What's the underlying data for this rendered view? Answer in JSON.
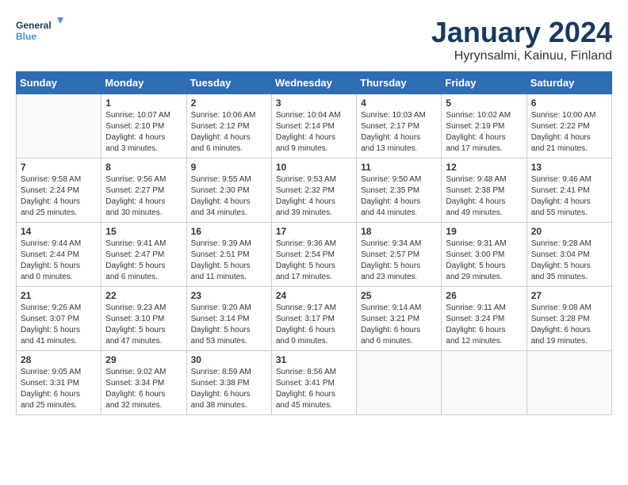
{
  "header": {
    "logo_line1": "General",
    "logo_line2": "Blue",
    "month": "January 2024",
    "location": "Hyrynsalmi, Kainuu, Finland"
  },
  "days_of_week": [
    "Sunday",
    "Monday",
    "Tuesday",
    "Wednesday",
    "Thursday",
    "Friday",
    "Saturday"
  ],
  "weeks": [
    [
      {
        "day": "",
        "info": ""
      },
      {
        "day": "1",
        "info": "Sunrise: 10:07 AM\nSunset: 2:10 PM\nDaylight: 4 hours\nand 3 minutes."
      },
      {
        "day": "2",
        "info": "Sunrise: 10:06 AM\nSunset: 2:12 PM\nDaylight: 4 hours\nand 6 minutes."
      },
      {
        "day": "3",
        "info": "Sunrise: 10:04 AM\nSunset: 2:14 PM\nDaylight: 4 hours\nand 9 minutes."
      },
      {
        "day": "4",
        "info": "Sunrise: 10:03 AM\nSunset: 2:17 PM\nDaylight: 4 hours\nand 13 minutes."
      },
      {
        "day": "5",
        "info": "Sunrise: 10:02 AM\nSunset: 2:19 PM\nDaylight: 4 hours\nand 17 minutes."
      },
      {
        "day": "6",
        "info": "Sunrise: 10:00 AM\nSunset: 2:22 PM\nDaylight: 4 hours\nand 21 minutes."
      }
    ],
    [
      {
        "day": "7",
        "info": "Sunrise: 9:58 AM\nSunset: 2:24 PM\nDaylight: 4 hours\nand 25 minutes."
      },
      {
        "day": "8",
        "info": "Sunrise: 9:56 AM\nSunset: 2:27 PM\nDaylight: 4 hours\nand 30 minutes."
      },
      {
        "day": "9",
        "info": "Sunrise: 9:55 AM\nSunset: 2:30 PM\nDaylight: 4 hours\nand 34 minutes."
      },
      {
        "day": "10",
        "info": "Sunrise: 9:53 AM\nSunset: 2:32 PM\nDaylight: 4 hours\nand 39 minutes."
      },
      {
        "day": "11",
        "info": "Sunrise: 9:50 AM\nSunset: 2:35 PM\nDaylight: 4 hours\nand 44 minutes."
      },
      {
        "day": "12",
        "info": "Sunrise: 9:48 AM\nSunset: 2:38 PM\nDaylight: 4 hours\nand 49 minutes."
      },
      {
        "day": "13",
        "info": "Sunrise: 9:46 AM\nSunset: 2:41 PM\nDaylight: 4 hours\nand 55 minutes."
      }
    ],
    [
      {
        "day": "14",
        "info": "Sunrise: 9:44 AM\nSunset: 2:44 PM\nDaylight: 5 hours\nand 0 minutes."
      },
      {
        "day": "15",
        "info": "Sunrise: 9:41 AM\nSunset: 2:47 PM\nDaylight: 5 hours\nand 6 minutes."
      },
      {
        "day": "16",
        "info": "Sunrise: 9:39 AM\nSunset: 2:51 PM\nDaylight: 5 hours\nand 11 minutes."
      },
      {
        "day": "17",
        "info": "Sunrise: 9:36 AM\nSunset: 2:54 PM\nDaylight: 5 hours\nand 17 minutes."
      },
      {
        "day": "18",
        "info": "Sunrise: 9:34 AM\nSunset: 2:57 PM\nDaylight: 5 hours\nand 23 minutes."
      },
      {
        "day": "19",
        "info": "Sunrise: 9:31 AM\nSunset: 3:00 PM\nDaylight: 5 hours\nand 29 minutes."
      },
      {
        "day": "20",
        "info": "Sunrise: 9:28 AM\nSunset: 3:04 PM\nDaylight: 5 hours\nand 35 minutes."
      }
    ],
    [
      {
        "day": "21",
        "info": "Sunrise: 9:26 AM\nSunset: 3:07 PM\nDaylight: 5 hours\nand 41 minutes."
      },
      {
        "day": "22",
        "info": "Sunrise: 9:23 AM\nSunset: 3:10 PM\nDaylight: 5 hours\nand 47 minutes."
      },
      {
        "day": "23",
        "info": "Sunrise: 9:20 AM\nSunset: 3:14 PM\nDaylight: 5 hours\nand 53 minutes."
      },
      {
        "day": "24",
        "info": "Sunrise: 9:17 AM\nSunset: 3:17 PM\nDaylight: 6 hours\nand 0 minutes."
      },
      {
        "day": "25",
        "info": "Sunrise: 9:14 AM\nSunset: 3:21 PM\nDaylight: 6 hours\nand 6 minutes."
      },
      {
        "day": "26",
        "info": "Sunrise: 9:11 AM\nSunset: 3:24 PM\nDaylight: 6 hours\nand 12 minutes."
      },
      {
        "day": "27",
        "info": "Sunrise: 9:08 AM\nSunset: 3:28 PM\nDaylight: 6 hours\nand 19 minutes."
      }
    ],
    [
      {
        "day": "28",
        "info": "Sunrise: 9:05 AM\nSunset: 3:31 PM\nDaylight: 6 hours\nand 25 minutes."
      },
      {
        "day": "29",
        "info": "Sunrise: 9:02 AM\nSunset: 3:34 PM\nDaylight: 6 hours\nand 32 minutes."
      },
      {
        "day": "30",
        "info": "Sunrise: 8:59 AM\nSunset: 3:38 PM\nDaylight: 6 hours\nand 38 minutes."
      },
      {
        "day": "31",
        "info": "Sunrise: 8:56 AM\nSunset: 3:41 PM\nDaylight: 6 hours\nand 45 minutes."
      },
      {
        "day": "",
        "info": ""
      },
      {
        "day": "",
        "info": ""
      },
      {
        "day": "",
        "info": ""
      }
    ]
  ]
}
